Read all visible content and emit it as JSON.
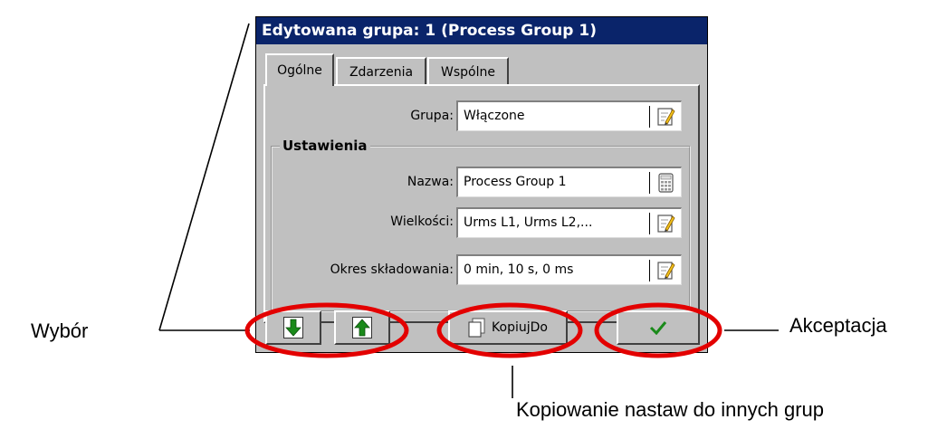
{
  "window": {
    "title": "Edytowana grupa: 1 (Process Group 1)"
  },
  "tabs": [
    {
      "label": "Ogólne"
    },
    {
      "label": "Zdarzenia"
    },
    {
      "label": "Wspólne"
    }
  ],
  "form": {
    "grupa": {
      "label": "Grupa:",
      "value": "Włączone",
      "icon": "edit-icon"
    },
    "settings_title": "Ustawienia",
    "nazwa": {
      "label": "Nazwa:",
      "value": "Process Group 1",
      "icon": "keyboard-icon"
    },
    "wielkosci": {
      "label": "Wielkości:",
      "value": "Urms L1, Urms L2,...",
      "icon": "edit-icon"
    },
    "okres": {
      "label": "Okres składowania:",
      "value": "0 min, 10 s, 0 ms",
      "icon": "edit-icon"
    }
  },
  "buttons": {
    "down": {
      "icon": "arrow-down-icon"
    },
    "up": {
      "icon": "arrow-up-icon"
    },
    "copy": {
      "label": "KopiujDo",
      "icon": "copy-icon"
    },
    "accept": {
      "icon": "checkmark-icon"
    }
  },
  "annotations": {
    "selection": "Wybór",
    "accept": "Akceptacja",
    "copy": "Kopiowanie nastaw do innych grup"
  },
  "colors": {
    "titlebar": "#0a246a",
    "highlight_ring": "#e30000",
    "arrow_green": "#1a8a1a"
  }
}
